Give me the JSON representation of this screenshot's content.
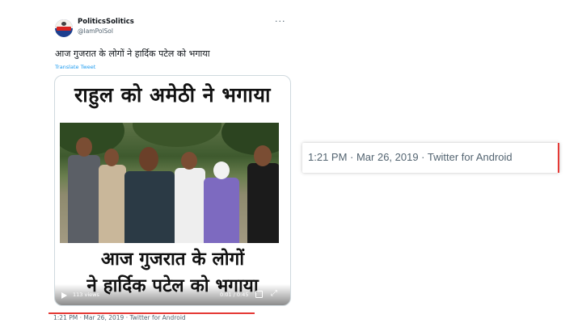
{
  "tweet": {
    "display_name": "PoliticsSolitics",
    "handle": "@IamPolSol",
    "more_icon": "more-horizontal-icon",
    "text": "आज गुजरात के लोगों ने हार्दिक पटेल को भगाया",
    "translate_label": "Translate Tweet",
    "media": {
      "headline_top": "राहुल को अमेठी ने भगाया",
      "headline_bottom_line1": "आज गुजरात के लोगों",
      "headline_bottom_line2": "ने हार्दिक पटेल को भगाया",
      "views": "113 views",
      "time": "0:01 / 0:45"
    },
    "timestamp": "1:21 PM · Mar 26, 2019 · Twitter for Android"
  },
  "zoom": {
    "timestamp": "1:21 PM · Mar 26, 2019 · Twitter for Android"
  },
  "colors": {
    "highlight": "#e53935",
    "link": "#1d9bf0",
    "muted": "#536471"
  }
}
